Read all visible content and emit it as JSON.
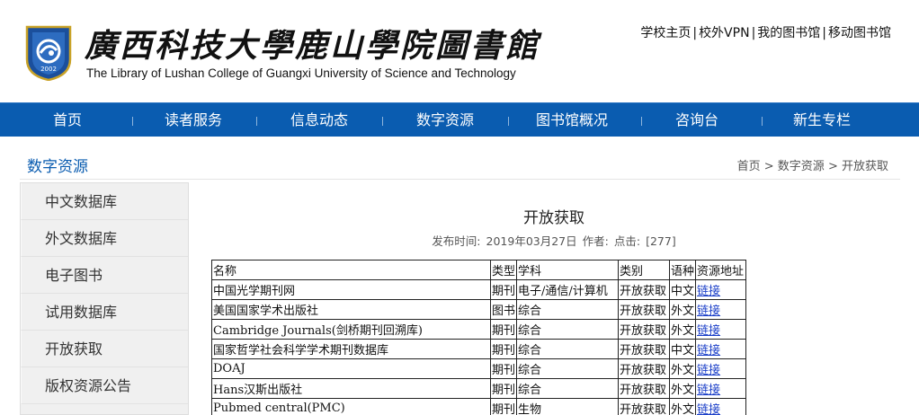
{
  "header": {
    "title": "廣西科技大學鹿山學院圖書館",
    "subtitle": "The Library of Lushan College of Guangxi University of Science and Technology",
    "emblem_year": "2002",
    "top_links": [
      "学校主页",
      "校外VPN",
      "我的图书馆",
      "移动图书馆"
    ],
    "top_separator": "|"
  },
  "nav": {
    "items": [
      "首页",
      "读者服务",
      "信息动态",
      "数字资源",
      "图书馆概况",
      "咨询台",
      "新生专栏"
    ]
  },
  "section": {
    "title": "数字资源",
    "breadcrumb": [
      "首页",
      "数字资源",
      "开放获取"
    ],
    "breadcrumb_separator": ">"
  },
  "sidebar": {
    "items": [
      "中文数据库",
      "外文数据库",
      "电子图书",
      "试用数据库",
      "开放获取",
      "版权资源公告"
    ]
  },
  "article": {
    "title": "开放获取",
    "published_label": "发布时间:",
    "published_date": "2019年03月27日",
    "author_label": "作者:",
    "clicks_label": "点击:",
    "clicks_value": "[277]"
  },
  "table": {
    "headers": [
      "名称",
      "类型",
      "学科",
      "类别",
      "语种",
      "资源地址"
    ],
    "rows": [
      [
        "中国光学期刊网",
        "期刊",
        "电子/通信/计算机",
        "开放获取",
        "中文",
        "链接"
      ],
      [
        "美国国家学术出版社",
        "图书",
        "综合",
        "开放获取",
        "外文",
        "链接"
      ],
      [
        "Cambridge Journals(剑桥期刊回溯库)",
        "期刊",
        "综合",
        "开放获取",
        "外文",
        "链接"
      ],
      [
        "国家哲学社会科学学术期刊数据库",
        "期刊",
        "综合",
        "开放获取",
        "中文",
        "链接"
      ],
      [
        "DOAJ",
        "期刊",
        "综合",
        "开放获取",
        "外文",
        "链接"
      ],
      [
        "Hans汉斯出版社",
        "期刊",
        "综合",
        "开放获取",
        "外文",
        "链接"
      ],
      [
        "Pubmed central(PMC)",
        "期刊",
        "生物",
        "开放获取",
        "外文",
        "链接"
      ]
    ]
  },
  "colors": {
    "nav_bg": "#0a5cb0",
    "accent": "#0a5cb0",
    "link": "#1a3ec8",
    "sidebar_bg": "#f0f0f0"
  }
}
